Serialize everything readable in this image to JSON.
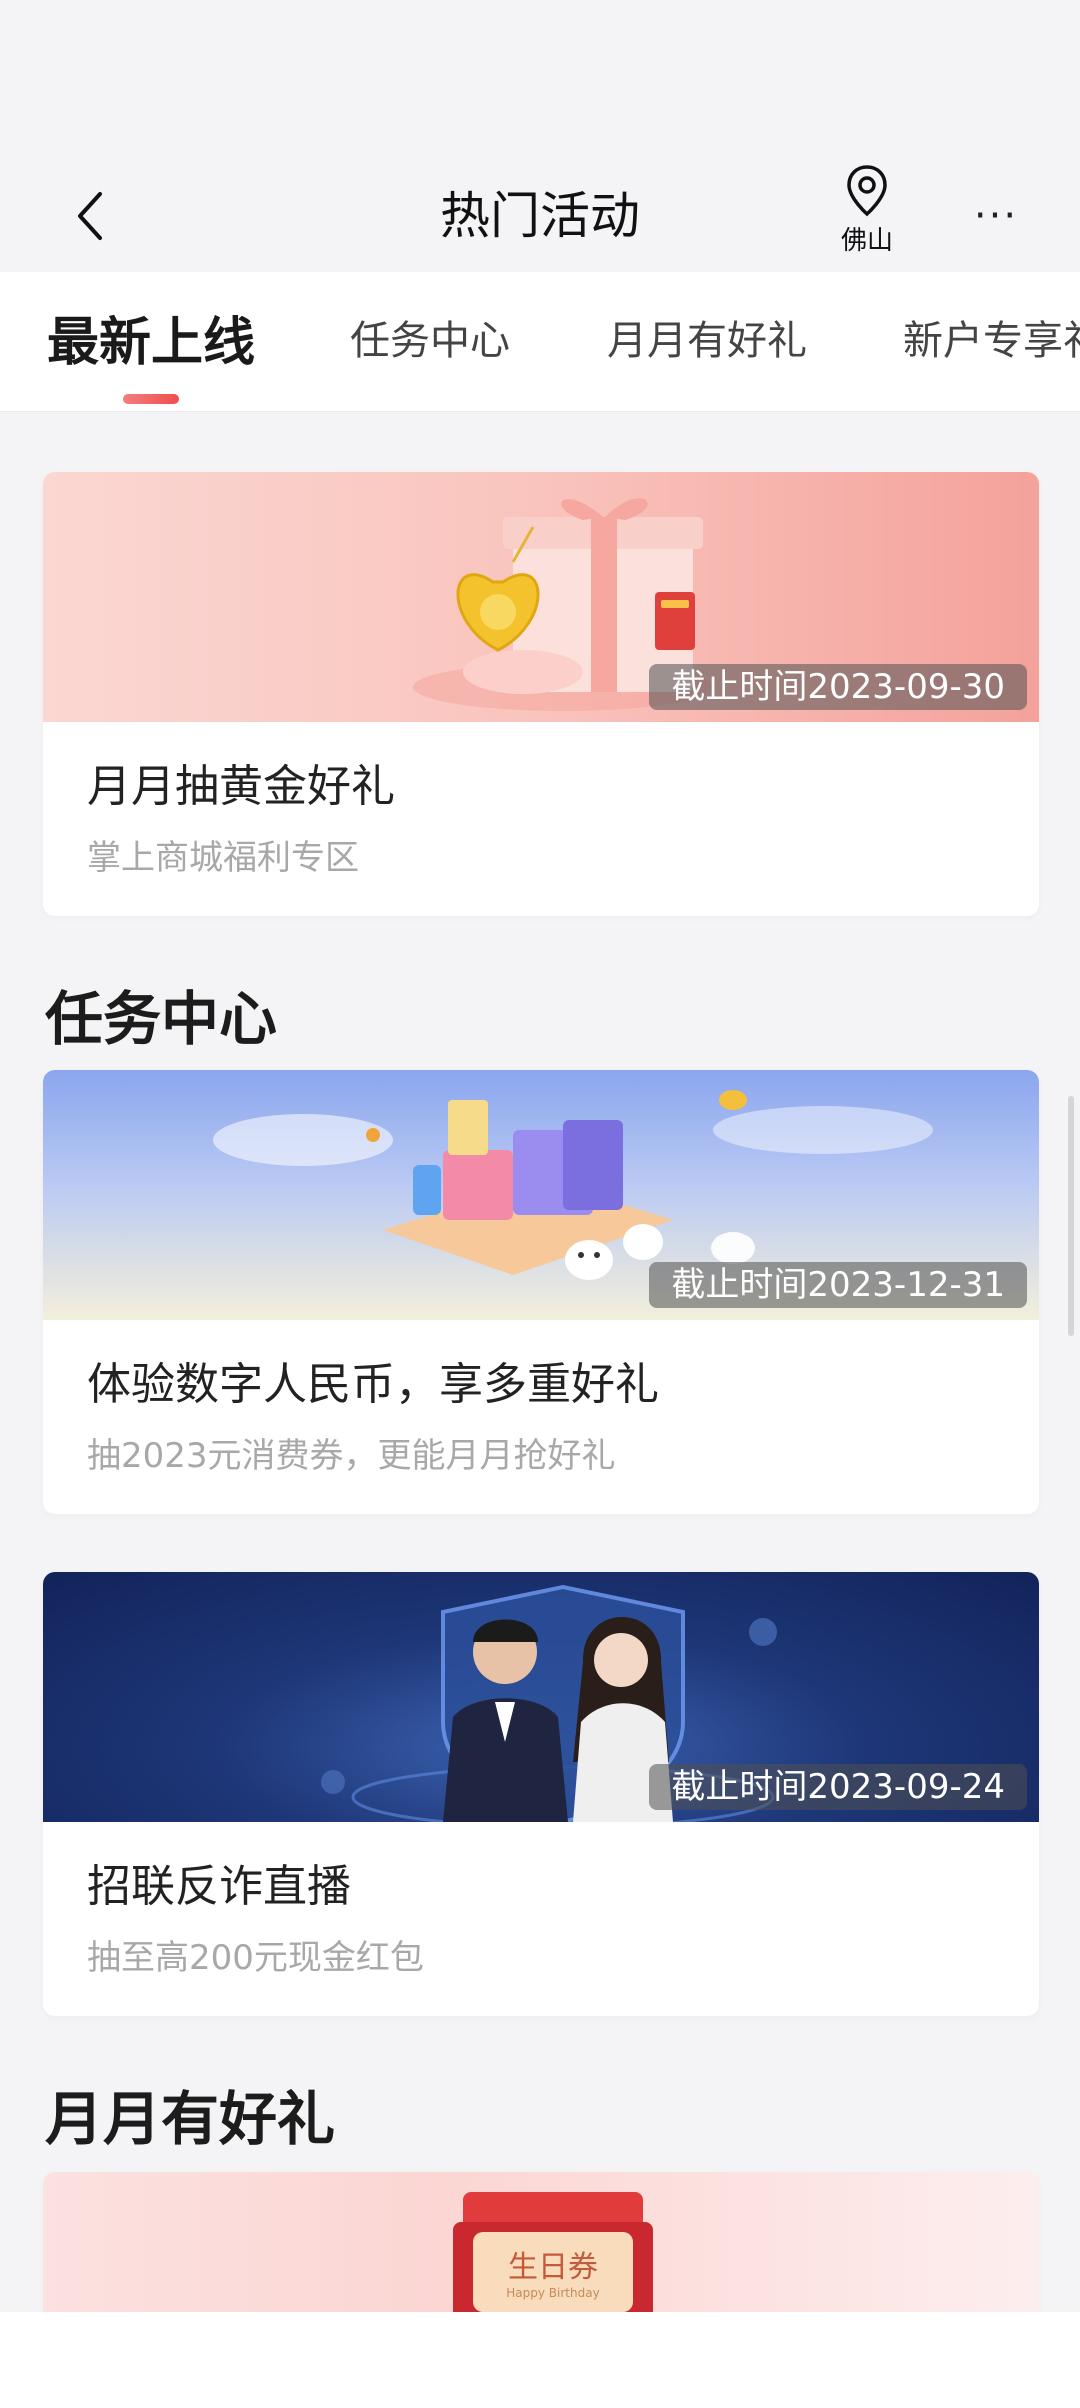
{
  "nav": {
    "title": "热门活动",
    "location": "佛山",
    "more_label": "···"
  },
  "tabs": [
    {
      "label": "最新上线",
      "active": true
    },
    {
      "label": "任务中心",
      "active": false
    },
    {
      "label": "月月有好礼",
      "active": false
    },
    {
      "label": "新户专享礼",
      "active": false
    }
  ],
  "cards": [
    {
      "title": "月月抽黄金好礼",
      "subtitle": "掌上商城福利专区",
      "deadline": "截止时间2023-09-30",
      "banner_colors": [
        "#f9c7c2",
        "#f6a8a2"
      ]
    },
    {
      "title": "体验数字人民币，享多重好礼",
      "subtitle": "抽2023元消费券，更能月月抢好礼",
      "deadline": "截止时间2023-12-31",
      "banner_colors": [
        "#8fa8ef",
        "#f5f0dc"
      ]
    },
    {
      "title": "招联反诈直播",
      "subtitle": "抽至高200元现金红包",
      "deadline": "截止时间2023-09-24",
      "banner_colors": [
        "#14265e",
        "#2d4a8e"
      ]
    }
  ],
  "sections": {
    "task_center": "任务中心",
    "monthly_gifts": "月月有好礼"
  },
  "partial_card": {
    "badge_text": "生日券",
    "badge_subtext": "Happy Birthday"
  }
}
